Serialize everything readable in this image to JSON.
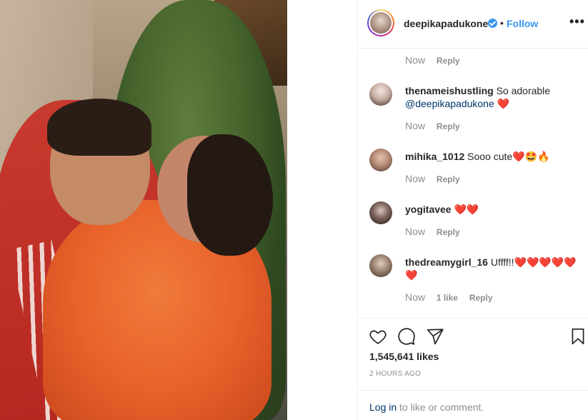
{
  "post": {
    "owner": "deepikapadukone",
    "separator": "•",
    "follow_label": "Follow",
    "more_label": "•••",
    "photo_alt": "photo"
  },
  "first_meta": {
    "time": "Now",
    "reply": "Reply"
  },
  "comments": [
    {
      "username": "thenameishustling",
      "text": " So adorable ",
      "mention": "@deepikapadukone",
      "emoji": " ❤️",
      "time": "Now",
      "likes": "",
      "reply": "Reply"
    },
    {
      "username": "mihika_1012",
      "text": " Sooo cute",
      "emoji": "❤️🤩🔥",
      "time": "Now",
      "likes": "",
      "reply": "Reply"
    },
    {
      "username": "yogitavee",
      "text": " ",
      "emoji": "❤️❤️",
      "time": "Now",
      "likes": "",
      "reply": "Reply"
    },
    {
      "username": "thedreamygirl_16",
      "text": " Uffff!!",
      "emoji": "❤️❤️❤️❤️❤️❤️",
      "time": "Now",
      "likes": "1 like",
      "reply": "Reply"
    }
  ],
  "actions": {
    "like_icon": "heart-outline-icon",
    "comment_icon": "speech-bubble-icon",
    "share_icon": "paper-plane-icon",
    "save_icon": "bookmark-icon",
    "likes_count": "1,545,641 likes",
    "timestamp": "2 HOURS AGO"
  },
  "login": {
    "link": "Log in",
    "text": " to like or comment."
  },
  "colors": {
    "link_blue": "#3897f0",
    "mention_blue": "#003569",
    "muted": "#8e8e8e",
    "heart": "#e02424"
  }
}
